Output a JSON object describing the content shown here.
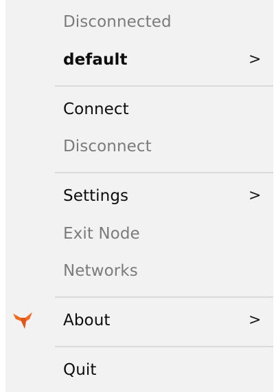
{
  "menu": {
    "status": "Disconnected",
    "profile": {
      "label": "default",
      "chevron": ">"
    },
    "connect": "Connect",
    "disconnect": "Disconnect",
    "settings": {
      "label": "Settings",
      "chevron": ">"
    },
    "exit_node": "Exit Node",
    "networks": "Networks",
    "about": {
      "label": "About",
      "chevron": ">",
      "icon": "app-logo-icon"
    },
    "quit": "Quit"
  },
  "colors": {
    "menu_bg": "#f2f2f2",
    "text": "#0d0d0d",
    "disabled_text": "#7b7b7b",
    "separator": "#dadada",
    "logo_orange": "#f26a1f"
  }
}
